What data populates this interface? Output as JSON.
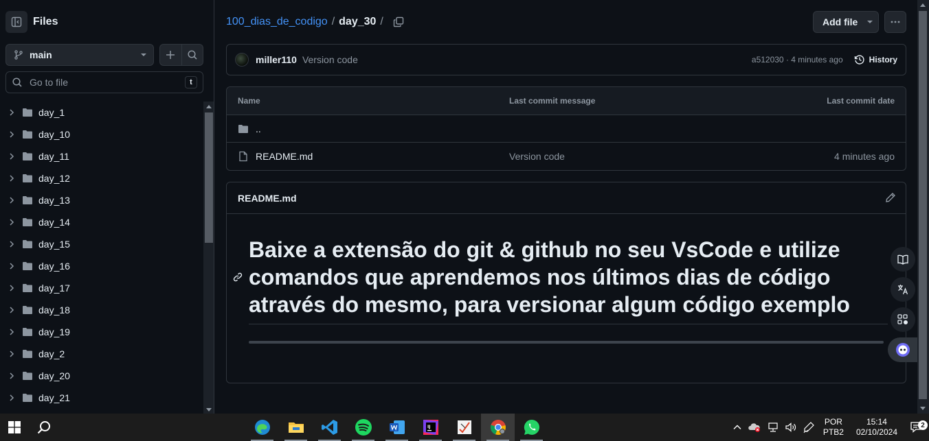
{
  "sidebar": {
    "title": "Files",
    "branch": "main",
    "goto_placeholder": "Go to file",
    "goto_shortcut": "t",
    "items": [
      {
        "label": "day_1"
      },
      {
        "label": "day_10"
      },
      {
        "label": "day_11"
      },
      {
        "label": "day_12"
      },
      {
        "label": "day_13"
      },
      {
        "label": "day_14"
      },
      {
        "label": "day_15"
      },
      {
        "label": "day_16"
      },
      {
        "label": "day_17"
      },
      {
        "label": "day_18"
      },
      {
        "label": "day_19"
      },
      {
        "label": "day_2"
      },
      {
        "label": "day_20"
      },
      {
        "label": "day_21"
      }
    ]
  },
  "header": {
    "repo": "100_dias_de_codigo",
    "separator": "/",
    "current": "day_30",
    "add_file_label": "Add file"
  },
  "commit": {
    "author": "miller110",
    "message": "Version code",
    "hash_time": "a512030 · 4 minutes ago",
    "history_label": "History"
  },
  "table": {
    "headers": [
      "Name",
      "Last commit message",
      "Last commit date"
    ],
    "rows": [
      {
        "name": "..",
        "message": "",
        "date": "",
        "icon": "folder-icon"
      },
      {
        "name": "README.md",
        "message": "Version code",
        "date": "4 minutes ago",
        "icon": "file-icon"
      }
    ]
  },
  "readme": {
    "title": "README.md",
    "heading": "Baixe a extensão do git & github no seu VsCode e utilize comandos que aprendemos nos últimos dias de código através do mesmo, para versionar algum código exemplo"
  },
  "taskbar": {
    "apps": [
      "edge-icon",
      "file-explorer-icon",
      "vscode-icon",
      "spotify-icon",
      "word-icon",
      "intellij-icon",
      "notes-app-icon",
      "chrome-icon",
      "whatsapp-icon"
    ],
    "lang": "POR",
    "layout": "PTB2",
    "time": "15:14",
    "date": "02/10/2024",
    "notif_count": "2"
  },
  "colors": {
    "accent": "#4493f8",
    "bg": "#0d1117",
    "border": "#30363d",
    "muted": "#8d96a0"
  }
}
